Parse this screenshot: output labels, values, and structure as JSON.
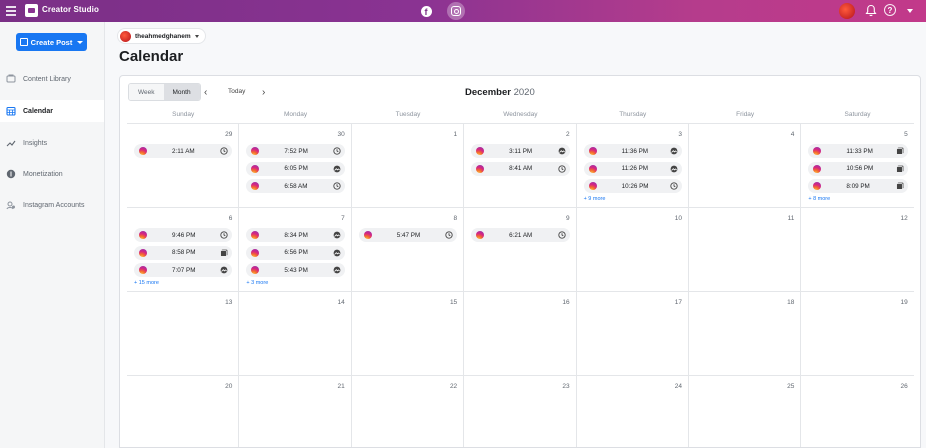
{
  "topbar": {
    "brand_title": "Creator Studio",
    "platform_fb_glyph": "f",
    "help_glyph": "?",
    "icons": [
      "hamburger-icon",
      "creator-studio-logo-icon",
      "facebook-icon",
      "instagram-icon",
      "avatar",
      "bell-icon",
      "help-icon",
      "caret-down-icon"
    ],
    "gradient": [
      "#7a2f86",
      "#c2398a"
    ]
  },
  "sidebar": {
    "create_label": "Create Post",
    "items": [
      {
        "label": "Content Library",
        "icon": "library-icon",
        "active": false
      },
      {
        "label": "Calendar",
        "icon": "calendar-icon",
        "active": true
      },
      {
        "label": "Insights",
        "icon": "insights-icon",
        "active": false
      },
      {
        "label": "Monetization",
        "icon": "monetization-icon",
        "active": false
      },
      {
        "label": "Instagram Accounts",
        "icon": "instagram-accounts-icon",
        "active": false
      }
    ],
    "accent": "#1877f2"
  },
  "header": {
    "account": "theahmedghanem",
    "title": "Calendar"
  },
  "toolbar": {
    "week_label": "Week",
    "month_label": "Month",
    "prev_glyph": "‹",
    "today_label": "Today",
    "next_glyph": "›",
    "month": "December",
    "year": "2020"
  },
  "weekdays": [
    "Sunday",
    "Monday",
    "Tuesday",
    "Wednesday",
    "Thursday",
    "Friday",
    "Saturday"
  ],
  "weeks": [
    [
      {
        "day": "29",
        "events": [
          {
            "time": "2:11 AM",
            "type": "clock"
          }
        ],
        "more": ""
      },
      {
        "day": "30",
        "events": [
          {
            "time": "7:52 PM",
            "type": "clock"
          },
          {
            "time": "6:05 PM",
            "type": "media"
          },
          {
            "time": "6:58 AM",
            "type": "clock"
          }
        ],
        "more": ""
      },
      {
        "day": "1",
        "events": [],
        "more": ""
      },
      {
        "day": "2",
        "events": [
          {
            "time": "3:11 PM",
            "type": "media"
          },
          {
            "time": "8:41 AM",
            "type": "clock"
          }
        ],
        "more": ""
      },
      {
        "day": "3",
        "events": [
          {
            "time": "11:36 PM",
            "type": "media"
          },
          {
            "time": "11:26 PM",
            "type": "media"
          },
          {
            "time": "10:26 PM",
            "type": "clock"
          }
        ],
        "more": "+ 9 more"
      },
      {
        "day": "4",
        "events": [],
        "more": ""
      },
      {
        "day": "5",
        "events": [
          {
            "time": "11:33 PM",
            "type": "carousel"
          },
          {
            "time": "10:56 PM",
            "type": "carousel"
          },
          {
            "time": "8:09 PM",
            "type": "carousel"
          }
        ],
        "more": "+ 8 more"
      }
    ],
    [
      {
        "day": "6",
        "events": [
          {
            "time": "9:46 PM",
            "type": "clock"
          },
          {
            "time": "8:58 PM",
            "type": "carousel"
          },
          {
            "time": "7:07 PM",
            "type": "media"
          }
        ],
        "more": "+ 15 more"
      },
      {
        "day": "7",
        "events": [
          {
            "time": "8:34 PM",
            "type": "media"
          },
          {
            "time": "6:56 PM",
            "type": "media"
          },
          {
            "time": "5:43 PM",
            "type": "media"
          }
        ],
        "more": "+ 3 more"
      },
      {
        "day": "8",
        "events": [
          {
            "time": "5:47 PM",
            "type": "clock"
          }
        ],
        "more": ""
      },
      {
        "day": "9",
        "events": [
          {
            "time": "6:21 AM",
            "type": "clock"
          }
        ],
        "more": ""
      },
      {
        "day": "10",
        "events": [],
        "more": ""
      },
      {
        "day": "11",
        "events": [],
        "more": ""
      },
      {
        "day": "12",
        "events": [],
        "more": ""
      }
    ],
    [
      {
        "day": "13",
        "events": [],
        "more": ""
      },
      {
        "day": "14",
        "events": [],
        "more": ""
      },
      {
        "day": "15",
        "events": [],
        "more": ""
      },
      {
        "day": "16",
        "events": [],
        "more": ""
      },
      {
        "day": "17",
        "events": [],
        "more": ""
      },
      {
        "day": "18",
        "events": [],
        "more": ""
      },
      {
        "day": "19",
        "events": [],
        "more": ""
      }
    ],
    [
      {
        "day": "20",
        "events": [],
        "more": ""
      },
      {
        "day": "21",
        "events": [],
        "more": ""
      },
      {
        "day": "22",
        "events": [],
        "more": ""
      },
      {
        "day": "23",
        "events": [],
        "more": ""
      },
      {
        "day": "24",
        "events": [],
        "more": ""
      },
      {
        "day": "25",
        "events": [],
        "more": ""
      },
      {
        "day": "26",
        "events": [],
        "more": ""
      }
    ]
  ]
}
